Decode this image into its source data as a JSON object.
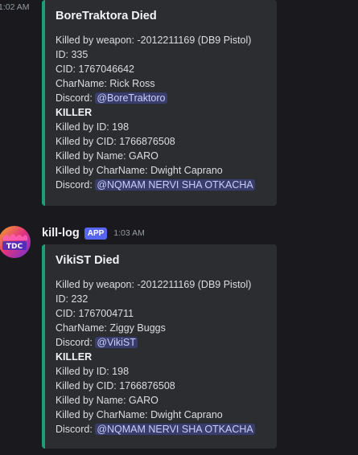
{
  "first_message": {
    "timestamp": "1:02 AM",
    "embed": {
      "title": "BoreTraktora Died",
      "lines": [
        {
          "prefix": "Killed by weapon: ",
          "value": "-2012211169 (DB9 Pistol)"
        },
        {
          "prefix": "ID: ",
          "value": "335"
        },
        {
          "prefix": "CID: ",
          "value": "1767046642"
        },
        {
          "prefix": "CharName: ",
          "value": "Rick Ross"
        },
        {
          "prefix": "Discord: ",
          "mention": "@BoreTraktoro"
        },
        {
          "heading": "KILLER"
        },
        {
          "prefix": "Killed by ID: ",
          "value": "198"
        },
        {
          "prefix": "Killed by CID: ",
          "value": "1766876508"
        },
        {
          "prefix": "Killed by Name: ",
          "value": "GARO"
        },
        {
          "prefix": "Killed by CharName: ",
          "value": "Dwight Caprano"
        },
        {
          "prefix": "Discord: ",
          "mention": "@NQMAM NERVI SHA OTKACHA"
        }
      ]
    }
  },
  "second_message": {
    "author": "kill-log",
    "badge": "APP",
    "timestamp": "1:03 AM",
    "avatar_text": "TDC",
    "embed": {
      "title": "VikiST Died",
      "lines": [
        {
          "prefix": "Killed by weapon: ",
          "value": "-2012211169 (DB9 Pistol)"
        },
        {
          "prefix": "ID: ",
          "value": "232"
        },
        {
          "prefix": "CID: ",
          "value": "1767004711"
        },
        {
          "prefix": "CharName: ",
          "value": "Ziggy Buggs"
        },
        {
          "prefix": "Discord: ",
          "mention": "@VikiST"
        },
        {
          "heading": "KILLER"
        },
        {
          "prefix": "Killed by ID: ",
          "value": "198"
        },
        {
          "prefix": "Killed by CID: ",
          "value": "1766876508"
        },
        {
          "prefix": "Killed by Name: ",
          "value": "GARO"
        },
        {
          "prefix": "Killed by CharName: ",
          "value": "Dwight Caprano"
        },
        {
          "prefix": "Discord: ",
          "mention": "@NQMAM NERVI SHA OTKACHA"
        }
      ]
    }
  },
  "colors": {
    "background": "#1a1a1e",
    "embed_background": "#2b2d31",
    "embed_accent": "#1e9f73",
    "mention_text": "#c9cdfb",
    "app_badge": "#5865f2"
  }
}
